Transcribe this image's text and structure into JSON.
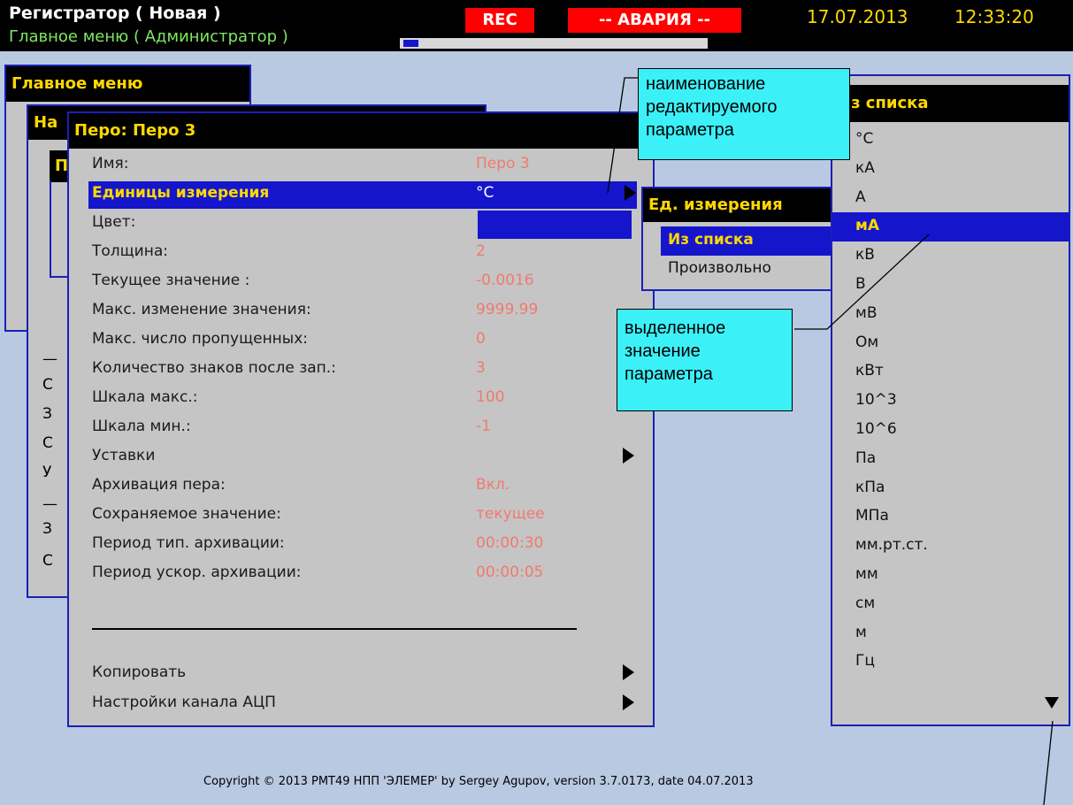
{
  "colors": {
    "accent": "#1515cc",
    "title_text": "#ffd800",
    "value_text": "#f07a6e",
    "alarm": "#ff0000",
    "screen_bg": "#b9c9e2",
    "callout": "#3cf0f8"
  },
  "topbar": {
    "title": "Регистратор ( Новая )",
    "subtitle": "Главное меню ( Администратор )",
    "rec": "REC",
    "alarm": "-- АВАРИЯ --",
    "date": "17.07.2013",
    "time": "12:33:20",
    "progress": 0.05
  },
  "bg_windows": {
    "main_menu_title": "Главное меню",
    "sub_title_fragment": "На",
    "sub2_title_fragment": "П",
    "left_fragments": [
      "У",
      "П",
      "—",
      "С",
      "З",
      "С",
      "У",
      "—",
      "З",
      "С"
    ]
  },
  "pen_dialog": {
    "title": "Перо: Перо 3",
    "rows": [
      {
        "label": "Имя:",
        "value": "Перо 3",
        "arrow": false
      },
      {
        "label": "Единицы измерения",
        "value": "°C",
        "arrow": true,
        "selected": true
      },
      {
        "label": "Цвет:",
        "value": "",
        "arrow": false,
        "color_swatch": "#1515cc"
      },
      {
        "label": "Толщина:",
        "value": "2",
        "arrow": false
      },
      {
        "label": "Текущее значение :",
        "value": "-0.0016",
        "arrow": false
      },
      {
        "label": "Макс. изменение значения:",
        "value": "9999.99",
        "arrow": false
      },
      {
        "label": "Макс. число пропущенных:",
        "value": "0",
        "arrow": false
      },
      {
        "label": "Количество знаков после зап.:",
        "value": "3",
        "arrow": false
      },
      {
        "label": "Шкала макс.:",
        "value": "100",
        "arrow": false
      },
      {
        "label": "Шкала мин.:",
        "value": "-1",
        "arrow": false
      },
      {
        "label": "Уставки",
        "value": "",
        "arrow": true
      },
      {
        "label": "Архивация пера:",
        "value": "Вкл.",
        "arrow": false
      },
      {
        "label": "Сохраняемое значение:",
        "value": "текущее",
        "arrow": false
      },
      {
        "label": "Период тип. архивации:",
        "value": "00:00:30",
        "arrow": false
      },
      {
        "label": "Период ускор. архивации:",
        "value": "00:00:05",
        "arrow": false
      }
    ],
    "bottom_rows": [
      {
        "label": "Копировать",
        "arrow": true
      },
      {
        "label": "Настройки канала АЦП",
        "arrow": true
      }
    ]
  },
  "units_submenu": {
    "title": "Ед. измерения",
    "items": [
      {
        "label": "Из списка",
        "selected": true
      },
      {
        "label": "Произвольно",
        "selected": false
      }
    ]
  },
  "units_list": {
    "title": "Из списка",
    "items": [
      "°C",
      "кА",
      "А",
      "мА",
      "кВ",
      "В",
      "мВ",
      "Ом",
      "кВт",
      "10^3",
      "10^6",
      "Па",
      "кПа",
      "МПа",
      "мм.рт.ст.",
      "мм",
      "см",
      "м",
      "Гц"
    ],
    "selected_index": 3,
    "scroll_icon": "scroll-down-arrow-icon"
  },
  "callouts": {
    "param_name": [
      "наименование",
      "редактируемого",
      "параметра"
    ],
    "selected_value": [
      "выделенное",
      "значение",
      "параметра"
    ]
  },
  "footer": {
    "copyright": "Copyright © 2013 PMT49 НПП 'ЭЛЕМЕР' by Sergey Agupov, version 3.7.0173, date 04.07.2013"
  }
}
